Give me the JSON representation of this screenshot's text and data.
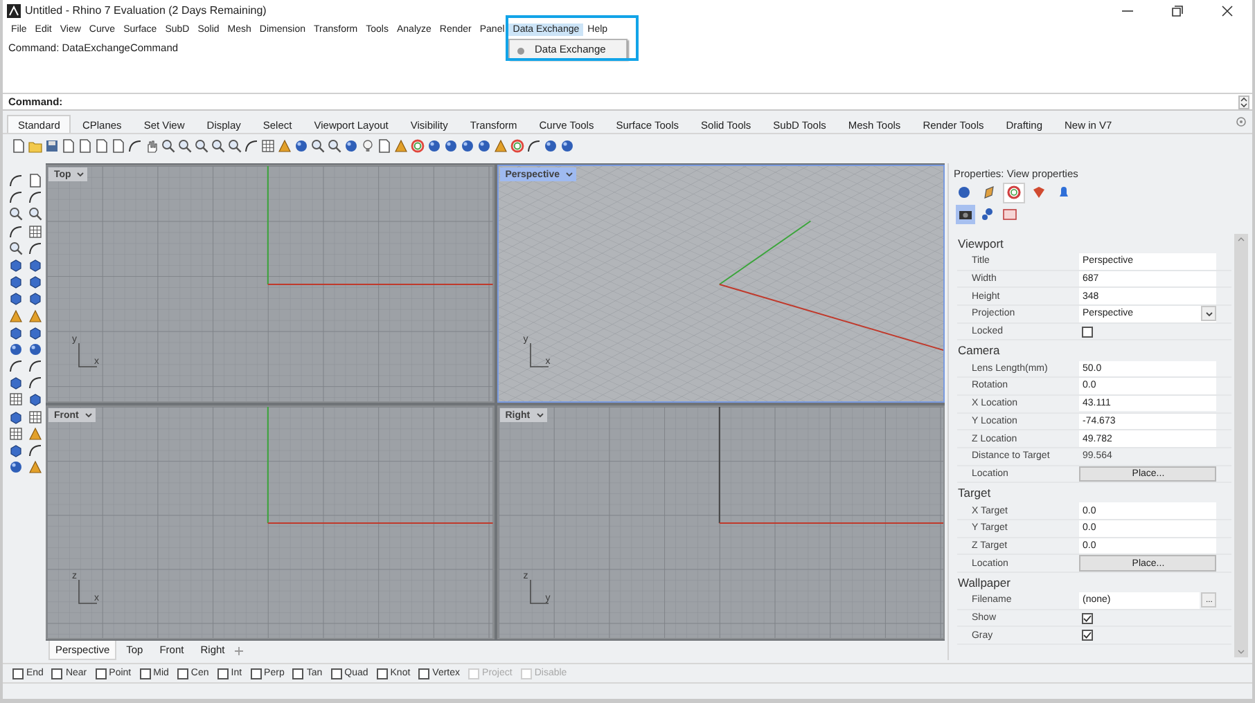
{
  "window": {
    "title": "Untitled - Rhino 7 Evaluation (2 Days Remaining)"
  },
  "menu_bar": [
    {
      "label": "File",
      "selected": false
    },
    {
      "label": "Edit",
      "selected": false
    },
    {
      "label": "View",
      "selected": false
    },
    {
      "label": "Curve",
      "selected": false
    },
    {
      "label": "Surface",
      "selected": false
    },
    {
      "label": "SubD",
      "selected": false
    },
    {
      "label": "Solid",
      "selected": false
    },
    {
      "label": "Mesh",
      "selected": false
    },
    {
      "label": "Dimension",
      "selected": false
    },
    {
      "label": "Transform",
      "selected": false
    },
    {
      "label": "Tools",
      "selected": false
    },
    {
      "label": "Analyze",
      "selected": false
    },
    {
      "label": "Render",
      "selected": false
    },
    {
      "label": "Panel",
      "selected": false
    },
    {
      "label": "Data Exchange",
      "selected": true
    },
    {
      "label": "Help",
      "selected": false
    }
  ],
  "open_menu": {
    "items": [
      "Data Exchange"
    ]
  },
  "command_history": [
    "Command: DataExchangeCommand"
  ],
  "command_prompt": "Command:",
  "toolbar_tabs": [
    {
      "label": "Standard",
      "selected": true
    },
    {
      "label": "CPlanes",
      "selected": false
    },
    {
      "label": "Set View",
      "selected": false
    },
    {
      "label": "Display",
      "selected": false
    },
    {
      "label": "Select",
      "selected": false
    },
    {
      "label": "Viewport Layout",
      "selected": false
    },
    {
      "label": "Visibility",
      "selected": false
    },
    {
      "label": "Transform",
      "selected": false
    },
    {
      "label": "Curve Tools",
      "selected": false
    },
    {
      "label": "Surface Tools",
      "selected": false
    },
    {
      "label": "Solid Tools",
      "selected": false
    },
    {
      "label": "SubD Tools",
      "selected": false
    },
    {
      "label": "Mesh Tools",
      "selected": false
    },
    {
      "label": "Render Tools",
      "selected": false
    },
    {
      "label": "Drafting",
      "selected": false
    },
    {
      "label": "New in V7",
      "selected": false
    }
  ],
  "viewports": [
    {
      "title": "Top",
      "selected": false,
      "kind": "plan",
      "axes": [
        "y",
        "x"
      ]
    },
    {
      "title": "Perspective",
      "selected": true,
      "kind": "perspective",
      "axes": [
        "y",
        "x"
      ]
    },
    {
      "title": "Front",
      "selected": false,
      "kind": "plan",
      "axes": [
        "z",
        "x"
      ]
    },
    {
      "title": "Right",
      "selected": false,
      "kind": "side",
      "axes": [
        "z",
        "y"
      ]
    }
  ],
  "viewport_tabs": [
    {
      "label": "Perspective",
      "selected": true
    },
    {
      "label": "Top",
      "selected": false
    },
    {
      "label": "Front",
      "selected": false
    },
    {
      "label": "Right",
      "selected": false
    }
  ],
  "properties": {
    "title": "Properties: View properties",
    "tabs": [
      {
        "selected": false
      },
      {
        "selected": false
      },
      {
        "selected": true
      },
      {
        "selected": false
      },
      {
        "selected": false
      }
    ],
    "subtabs": [
      {
        "selected": true
      },
      {
        "selected": false
      },
      {
        "selected": false
      }
    ],
    "sections": [
      {
        "title": "Viewport",
        "rows": [
          {
            "kind": "text",
            "label": "Title",
            "value": "Perspective"
          },
          {
            "kind": "text",
            "label": "Width",
            "value": "687"
          },
          {
            "kind": "text",
            "label": "Height",
            "value": "348"
          },
          {
            "kind": "dropdown",
            "label": "Projection",
            "value": "Perspective"
          },
          {
            "kind": "checkbox",
            "label": "Locked",
            "checked": false
          }
        ]
      },
      {
        "title": "Camera",
        "rows": [
          {
            "kind": "text",
            "label": "Lens Length(mm)",
            "value": "50.0"
          },
          {
            "kind": "text",
            "label": "Rotation",
            "value": "0.0"
          },
          {
            "kind": "text",
            "label": "X Location",
            "value": "43.111"
          },
          {
            "kind": "text",
            "label": "Y Location",
            "value": "-74.673"
          },
          {
            "kind": "text",
            "label": "Z Location",
            "value": "49.782"
          },
          {
            "kind": "readonly",
            "label": "Distance to Target",
            "value": "99.564"
          },
          {
            "kind": "button",
            "label": "Location",
            "value": "Place..."
          }
        ]
      },
      {
        "title": "Target",
        "rows": [
          {
            "kind": "text",
            "label": "X Target",
            "value": "0.0"
          },
          {
            "kind": "text",
            "label": "Y Target",
            "value": "0.0"
          },
          {
            "kind": "text",
            "label": "Z Target",
            "value": "0.0"
          },
          {
            "kind": "button",
            "label": "Location",
            "value": "Place..."
          }
        ]
      },
      {
        "title": "Wallpaper",
        "rows": [
          {
            "kind": "file",
            "label": "Filename",
            "value": "(none)",
            "button": "..."
          },
          {
            "kind": "checkbox",
            "label": "Show",
            "checked": true
          },
          {
            "kind": "checkbox",
            "label": "Gray",
            "checked": true
          }
        ]
      }
    ]
  },
  "osnaps": [
    {
      "label": "End",
      "checked": false,
      "disabled": false
    },
    {
      "label": "Near",
      "checked": false,
      "disabled": false
    },
    {
      "label": "Point",
      "checked": false,
      "disabled": false
    },
    {
      "label": "Mid",
      "checked": false,
      "disabled": false
    },
    {
      "label": "Cen",
      "checked": false,
      "disabled": false
    },
    {
      "label": "Int",
      "checked": false,
      "disabled": false
    },
    {
      "label": "Perp",
      "checked": false,
      "disabled": false
    },
    {
      "label": "Tan",
      "checked": false,
      "disabled": false
    },
    {
      "label": "Quad",
      "checked": false,
      "disabled": false
    },
    {
      "label": "Knot",
      "checked": false,
      "disabled": false
    },
    {
      "label": "Vertex",
      "checked": false,
      "disabled": false
    },
    {
      "label": "Project",
      "checked": false,
      "disabled": true
    },
    {
      "label": "Disable",
      "checked": false,
      "disabled": true
    }
  ]
}
